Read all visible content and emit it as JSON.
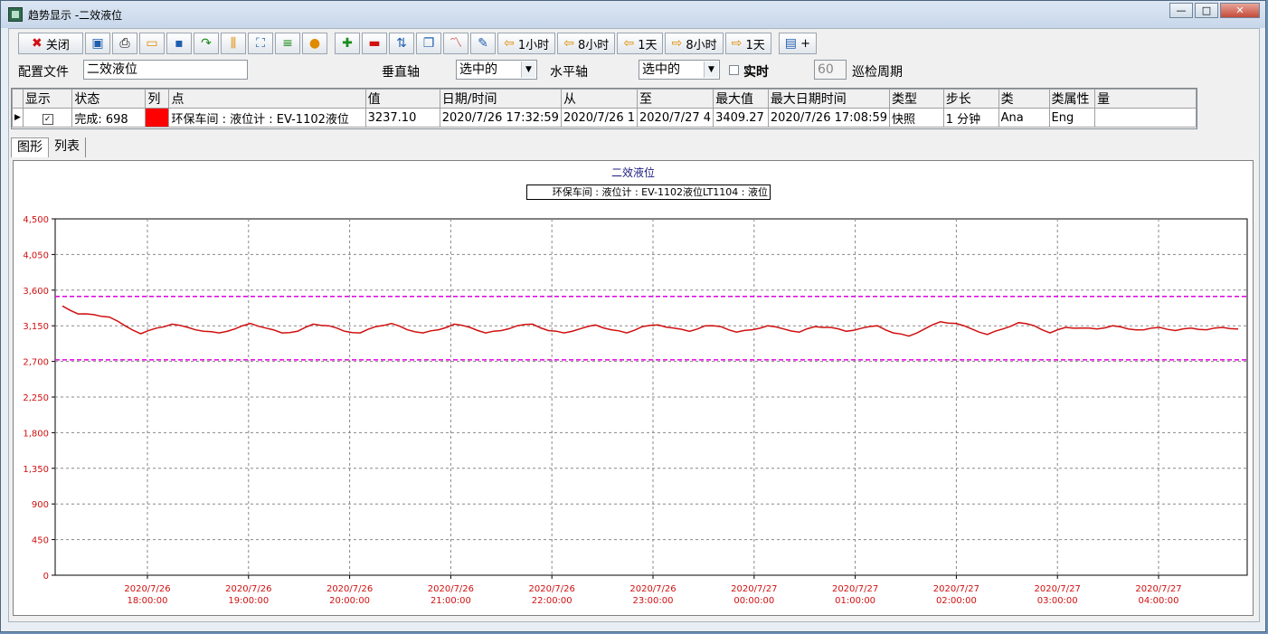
{
  "window": {
    "title": "趋势显示 -二效液位",
    "controls": {
      "minimize": "—",
      "maximize": "□",
      "close": "✕"
    }
  },
  "toolbar": {
    "close_label": "关闭",
    "back_1h": "1小时",
    "back_8h": "8小时",
    "back_1d": "1天",
    "fwd_8h": "8小时",
    "fwd_1d": "1天",
    "extra_label": "+"
  },
  "config": {
    "file_label": "配置文件",
    "file_value": "二效液位",
    "vaxis_label": "垂直轴",
    "vaxis_value": "选中的",
    "haxis_label": "水平轴",
    "haxis_value": "选中的",
    "realtime_label": "实时",
    "interval_value": "60",
    "interval_label": "巡检周期"
  },
  "grid": {
    "headers": [
      "显示",
      "状态",
      "列",
      "点",
      "值",
      "日期/时间",
      "从",
      "至",
      "最大值",
      "最大日期时间",
      "类型",
      "步长",
      "类",
      "类属性",
      "量"
    ],
    "row": {
      "status": "完成: 698",
      "point": "环保车间 : 液位计 : EV-1102液位",
      "value": "3237.10",
      "datetime": "2020/7/26 17:32:59",
      "from": "2020/7/26 1",
      "to": "2020/7/27 4",
      "max_value": "3409.27",
      "max_datetime": "2020/7/26 17:08:59",
      "type": "快照",
      "step": "1 分钟",
      "class": "Ana",
      "class_attr": "Eng",
      "qty": ""
    }
  },
  "tabs": [
    "图形",
    "列表"
  ],
  "colors": {
    "series": "#d01010",
    "limit": "#e000e0",
    "accent": "#d01010"
  },
  "chart_data": {
    "type": "line",
    "title": "二效液位",
    "legend": "环保车间 : 液位计 : EV-1102液位LT1104 : 液位",
    "ylim": [
      0,
      4500
    ],
    "yticks": [
      "0",
      "450",
      "900",
      "1,350",
      "1,800",
      "2,250",
      "2,700",
      "3,150",
      "3,600",
      "4,050",
      "4,500"
    ],
    "x_labels": [
      [
        "2020/7/26",
        "18:00:00"
      ],
      [
        "2020/7/26",
        "19:00:00"
      ],
      [
        "2020/7/26",
        "20:00:00"
      ],
      [
        "2020/7/26",
        "21:00:00"
      ],
      [
        "2020/7/26",
        "22:00:00"
      ],
      [
        "2020/7/26",
        "23:00:00"
      ],
      [
        "2020/7/27",
        "00:00:00"
      ],
      [
        "2020/7/27",
        "01:00:00"
      ],
      [
        "2020/7/27",
        "02:00:00"
      ],
      [
        "2020/7/27",
        "03:00:00"
      ],
      [
        "2020/7/27",
        "04:00:00"
      ]
    ],
    "limits": [
      3520,
      2720
    ],
    "series": [
      {
        "values": [
          3400,
          3300,
          3290,
          3260,
          3150,
          3050,
          3120,
          3170,
          3130,
          3080,
          3060,
          3110,
          3180,
          3120,
          3060,
          3080,
          3170,
          3150,
          3080,
          3060,
          3140,
          3180,
          3100,
          3060,
          3100,
          3170,
          3130,
          3060,
          3090,
          3150,
          3170,
          3090,
          3060,
          3110,
          3160,
          3100,
          3060,
          3140,
          3160,
          3120,
          3080,
          3150,
          3140,
          3070,
          3100,
          3150,
          3110,
          3070,
          3140,
          3130,
          3080,
          3120,
          3150,
          3060,
          3020,
          3110,
          3200,
          3180,
          3110,
          3040,
          3110,
          3190,
          3150,
          3060,
          3130,
          3120,
          3110,
          3150,
          3110,
          3100,
          3130,
          3090,
          3120,
          3100,
          3130,
          3110
        ]
      }
    ]
  }
}
